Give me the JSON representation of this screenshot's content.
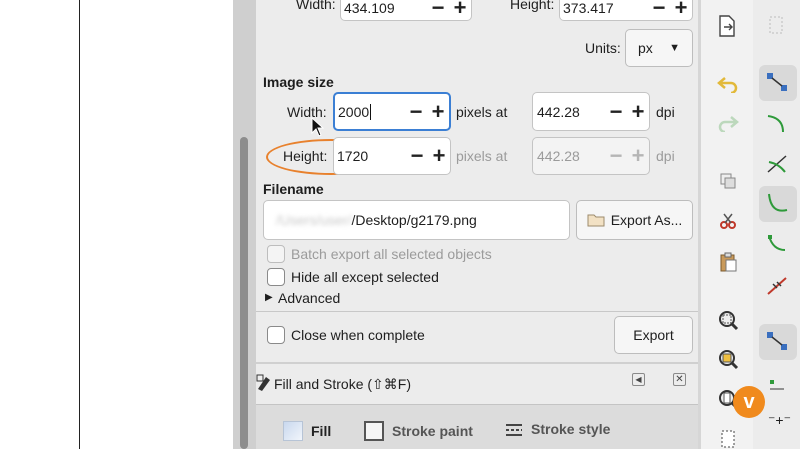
{
  "dimensions": {
    "width_label": "Width:",
    "width_value": "434.109",
    "height_label": "Height:",
    "height_value": "373.417",
    "units_label": "Units:",
    "units_value": "px"
  },
  "image_size": {
    "heading": "Image size",
    "width_label": "Width:",
    "width_value": "2000",
    "height_label": "Height:",
    "height_value": "1720",
    "pixels_at": "pixels at",
    "dpi_value": "442.28",
    "dpi_value_disabled": "442.28",
    "dpi_label": "dpi"
  },
  "filename": {
    "heading": "Filename",
    "path_blurred": "/Users/user/",
    "path_visible": "/Desktop/g2179.png",
    "export_as_label": "Export As..."
  },
  "options": {
    "batch_export": "Batch export all selected objects",
    "hide_all": "Hide all except selected",
    "advanced": "Advanced",
    "close_when_complete": "Close when complete",
    "export_label": "Export"
  },
  "fill_stroke": {
    "title": "Fill and Stroke (⇧⌘F)",
    "tabs": [
      "Fill",
      "Stroke paint",
      "Stroke style"
    ]
  },
  "colors": {
    "accent": "#3b7fd4",
    "highlight": "#e8812d",
    "vimeo_badge": "#f08a1d"
  }
}
